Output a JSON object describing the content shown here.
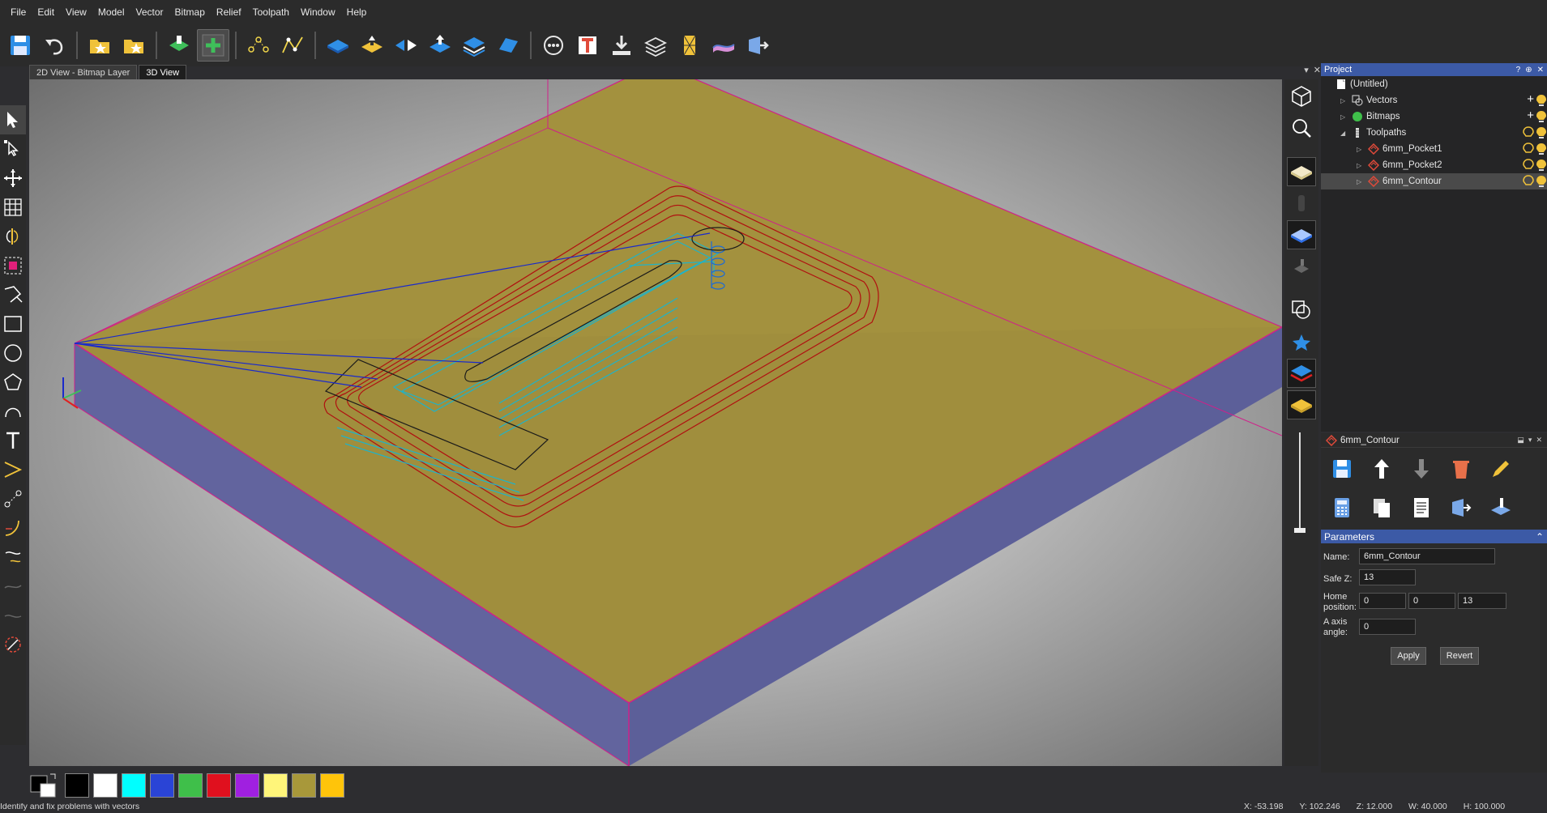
{
  "menu": [
    "File",
    "Edit",
    "View",
    "Model",
    "Vector",
    "Bitmap",
    "Relief",
    "Toolpath",
    "Window",
    "Help"
  ],
  "toolbar": [
    {
      "icon": "save-icon",
      "color": "#2f8fe6"
    },
    {
      "icon": "undo-icon",
      "color": "#e8e8e8"
    },
    {
      "icon": "open-folder-icon",
      "color": "#f0c23a"
    },
    {
      "icon": "favorite-folder-icon",
      "color": "#f0c23a"
    },
    {
      "icon": "model-layer-icon",
      "color": "#3fbf5a"
    },
    {
      "icon": "add-relief-icon",
      "color": "#3fbf5a"
    },
    {
      "icon": "vector-nodes-icon",
      "color": "#f0d54a"
    },
    {
      "icon": "vector-curve-icon",
      "color": "#f0d54a"
    },
    {
      "icon": "relief-flat-icon",
      "color": "#2f8fe6"
    },
    {
      "icon": "relief-raise-icon",
      "color": "#f0c23a"
    },
    {
      "icon": "relief-mirror-icon",
      "color": "#2f8fe6"
    },
    {
      "icon": "relief-up-icon",
      "color": "#2f8fe6"
    },
    {
      "icon": "relief-stack-icon",
      "color": "#2f8fe6"
    },
    {
      "icon": "relief-tilt-icon",
      "color": "#2f8fe6"
    },
    {
      "icon": "gauge-icon",
      "color": "#e8e8e8"
    },
    {
      "icon": "text-tool-icon",
      "color": "#e04a3a"
    },
    {
      "icon": "import-icon",
      "color": "#e8e8e8"
    },
    {
      "icon": "layers-icon",
      "color": "#e8e8e8"
    },
    {
      "icon": "texture-icon",
      "color": "#f0c23a"
    },
    {
      "icon": "surface-icon",
      "color": "#d88fd8"
    },
    {
      "icon": "toolpath-save-icon",
      "color": "#e8e8e8"
    }
  ],
  "tabs": [
    {
      "label": "2D View - Bitmap Layer",
      "active": false
    },
    {
      "label": "3D View",
      "active": true
    }
  ],
  "project": {
    "title": "Project",
    "controls": [
      "?",
      "⊕",
      "✕"
    ],
    "tree": [
      {
        "label": "(Untitled)",
        "level": 0,
        "icon": "document-icon",
        "caret": ""
      },
      {
        "label": "Vectors",
        "level": 1,
        "icon": "vectors-icon",
        "caret": "▷"
      },
      {
        "label": "Bitmaps",
        "level": 1,
        "icon": "bitmaps-icon",
        "caret": "▷"
      },
      {
        "label": "Toolpaths",
        "level": 1,
        "icon": "toolpaths-icon",
        "caret": "◢"
      },
      {
        "label": "6mm_Pocket1",
        "level": 2,
        "icon": "toolpath-item-icon",
        "caret": "▷"
      },
      {
        "label": "6mm_Pocket2",
        "level": 2,
        "icon": "toolpath-item-icon",
        "caret": "▷"
      },
      {
        "label": "6mm_Contour",
        "level": 2,
        "icon": "toolpath-item-icon",
        "caret": "▷",
        "selected": true
      }
    ]
  },
  "toolpath_panel": {
    "title": "6mm_Contour"
  },
  "parameters": {
    "title": "Parameters",
    "name_label": "Name:",
    "name_value": "6mm_Contour",
    "safez_label": "Safe Z:",
    "safez_value": "13",
    "home_label_1": "Home",
    "home_label_2": "position:",
    "home_x": "0",
    "home_y": "0",
    "home_z": "13",
    "aaxis_label_1": "A axis",
    "aaxis_label_2": "angle:",
    "aaxis_value": "0",
    "apply": "Apply",
    "revert": "Revert"
  },
  "palette": [
    "#000000",
    "#ffffff",
    "#00ffff",
    "#2a44d6",
    "#3fbf4a",
    "#e0101e",
    "#a020e0",
    "#fff57a",
    "#a8983a",
    "#ffc40a"
  ],
  "status": {
    "message": "Identify and fix problems with vectors",
    "x": "X: -53.198",
    "y": "Y: 102.246",
    "z": "Z: 12.000",
    "w": "W: 40.000",
    "h": "H: 100.000"
  }
}
